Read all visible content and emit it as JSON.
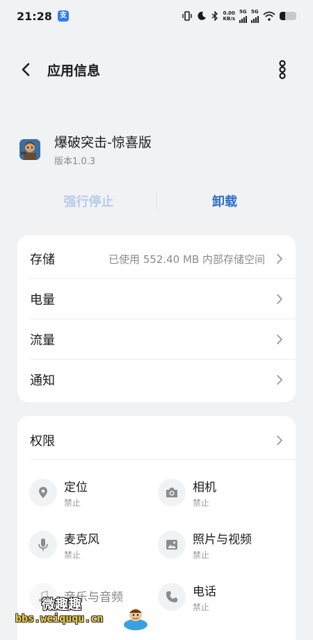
{
  "status_bar": {
    "time": "21:28",
    "app_badge": "支",
    "net_speed_value": "0.00",
    "net_speed_unit": "KB/s",
    "sim1_label": "5G",
    "sim2_label": "5G",
    "battery_level": 0.35,
    "icons": [
      "vibrate-icon",
      "moon-icon",
      "bluetooth-icon",
      "signal-icon",
      "wifi-icon",
      "battery-icon"
    ]
  },
  "header": {
    "title": "应用信息",
    "back_icon": "chevron-left-icon",
    "more_icon": "more-vertical-icon"
  },
  "app": {
    "name": "爆破突击-惊喜版",
    "version": "版本1.0.3"
  },
  "actions": {
    "force_stop": "强行停止",
    "uninstall": "卸载"
  },
  "settings": [
    {
      "label": "存储",
      "value": "已使用 552.40 MB 内部存储空间"
    },
    {
      "label": "电量",
      "value": ""
    },
    {
      "label": "流量",
      "value": ""
    },
    {
      "label": "通知",
      "value": ""
    }
  ],
  "permissions": {
    "title": "权限",
    "items": [
      {
        "name": "定位",
        "status": "禁止",
        "icon": "location-icon"
      },
      {
        "name": "相机",
        "status": "禁止",
        "icon": "camera-icon"
      },
      {
        "name": "麦克风",
        "status": "禁止",
        "icon": "microphone-icon"
      },
      {
        "name": "照片与视频",
        "status": "禁止",
        "icon": "image-icon"
      },
      {
        "name": "音乐与音频",
        "status": "",
        "icon": "music-icon"
      },
      {
        "name": "电话",
        "status": "禁止",
        "icon": "phone-icon"
      }
    ]
  },
  "watermark": {
    "line1": "微趣趣",
    "line2": "bbs.weiququ.cn"
  },
  "colors": {
    "background": "#f1f2f4",
    "card": "#ffffff",
    "accent": "#2c6fcc",
    "disabled": "#b7ccea",
    "secondary_text": "#8a8a8a"
  }
}
